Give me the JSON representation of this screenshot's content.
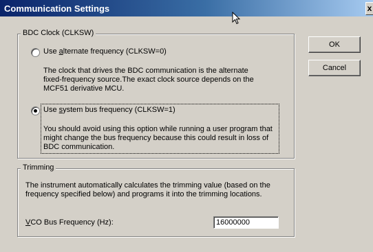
{
  "window": {
    "title": "Communication Settings",
    "close_glyph": "x"
  },
  "bdc_clock": {
    "group_label": "BDC Clock (CLKSW)",
    "option_alternate": {
      "label_prefix": "Use ",
      "label_accel": "a",
      "label_suffix": "lternate frequency (CLKSW=0)",
      "selected": false,
      "description": [
        "The clock that drives the BDC communication is the alternate",
        "fixed-frequency source.The exact clock source depends on the",
        "MCF51 derivative MCU."
      ]
    },
    "option_system": {
      "label_prefix": "Use ",
      "label_accel": "s",
      "label_suffix": "ystem bus frequency (CLKSW=1)",
      "selected": true,
      "description": [
        "You should avoid using this option while running a user program that",
        "might change the bus frequency because this could result in loss of",
        "BDC communication."
      ]
    }
  },
  "trimming": {
    "group_label": "Trimming",
    "description": [
      "The instrument automatically calculates the trimming value (based on the",
      "frequency specified below) and programs it into the trimming locations."
    ],
    "vco_label_accel": "V",
    "vco_label_rest": "CO Bus Frequency (Hz):",
    "vco_value": "16000000"
  },
  "buttons": {
    "ok": "OK",
    "cancel": "Cancel"
  },
  "colors": {
    "dialog_face": "#d4d0c8",
    "title_start": "#0a246a",
    "title_end": "#a6caf0"
  },
  "icons": {
    "cursor": "mouse-pointer-icon"
  }
}
